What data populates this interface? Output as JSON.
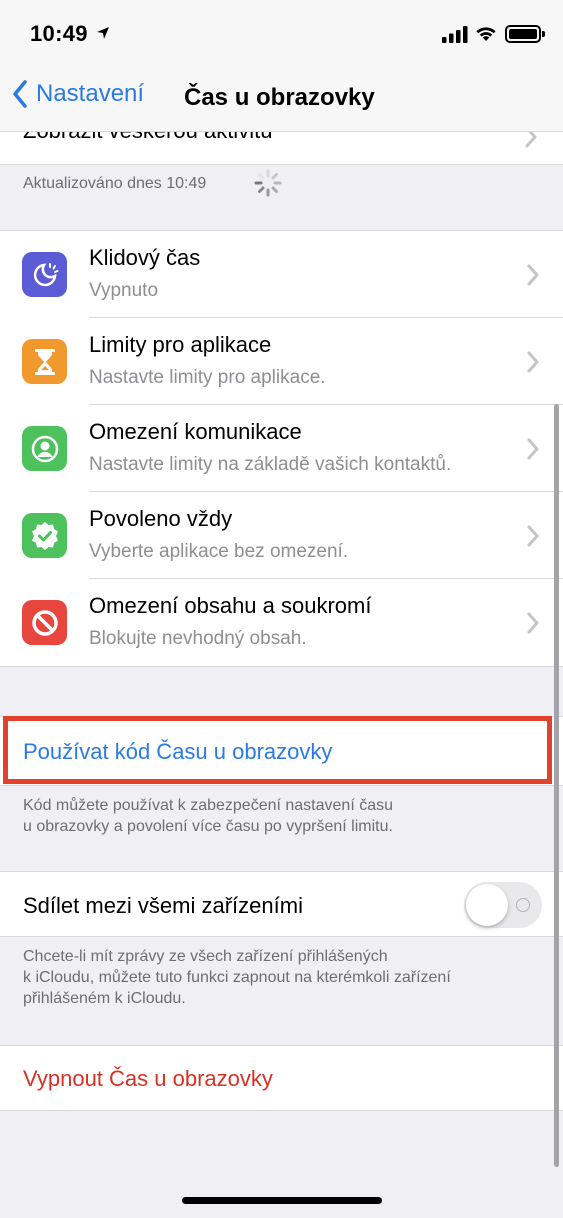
{
  "status": {
    "time": "10:49"
  },
  "nav": {
    "back_label": "Nastavení",
    "title": "Čas u obrazovky"
  },
  "activity": {
    "label": "Zobrazit veškerou aktivitu",
    "updated": "Aktualizováno dnes 10:49"
  },
  "items": [
    {
      "title": "Klidový čas",
      "subtitle": "Vypnuto",
      "icon": "downtime-icon",
      "color": "#5b5bd6"
    },
    {
      "title": "Limity pro aplikace",
      "subtitle": "Nastavte limity pro aplikace.",
      "icon": "hourglass-icon",
      "color": "#f2992e"
    },
    {
      "title": "Omezení komunikace",
      "subtitle": "Nastavte limity na základě vašich kontaktů.",
      "icon": "contact-icon",
      "color": "#4cc15c"
    },
    {
      "title": "Povoleno vždy",
      "subtitle": "Vyberte aplikace bez omezení.",
      "icon": "checkmark-badge-icon",
      "color": "#4cc15c"
    },
    {
      "title": "Omezení obsahu a soukromí",
      "subtitle": "Blokujte nevhodný obsah.",
      "icon": "no-entry-icon",
      "color": "#e8453c"
    }
  ],
  "passcode": {
    "label": "Používat kód Času u obrazovky",
    "note_line1": "Kód můžete používat k zabezpečení nastavení času",
    "note_line2": "u obrazovky a povolení více času po vypršení limitu."
  },
  "share": {
    "label": "Sdílet mezi všemi zařízeními",
    "enabled": false,
    "note_line1": "Chcete-li mít zprávy ze všech zařízení přihlášených",
    "note_line2": "k iCloudu, můžete tuto funkci zapnout na kterémkoli zařízení",
    "note_line3": "přihlášeném k iCloudu."
  },
  "turn_off": {
    "label": "Vypnout Čas u obrazovky"
  },
  "colors": {
    "link": "#2a7ae2",
    "destructive": "#d93025",
    "highlight": "#e2412c"
  }
}
